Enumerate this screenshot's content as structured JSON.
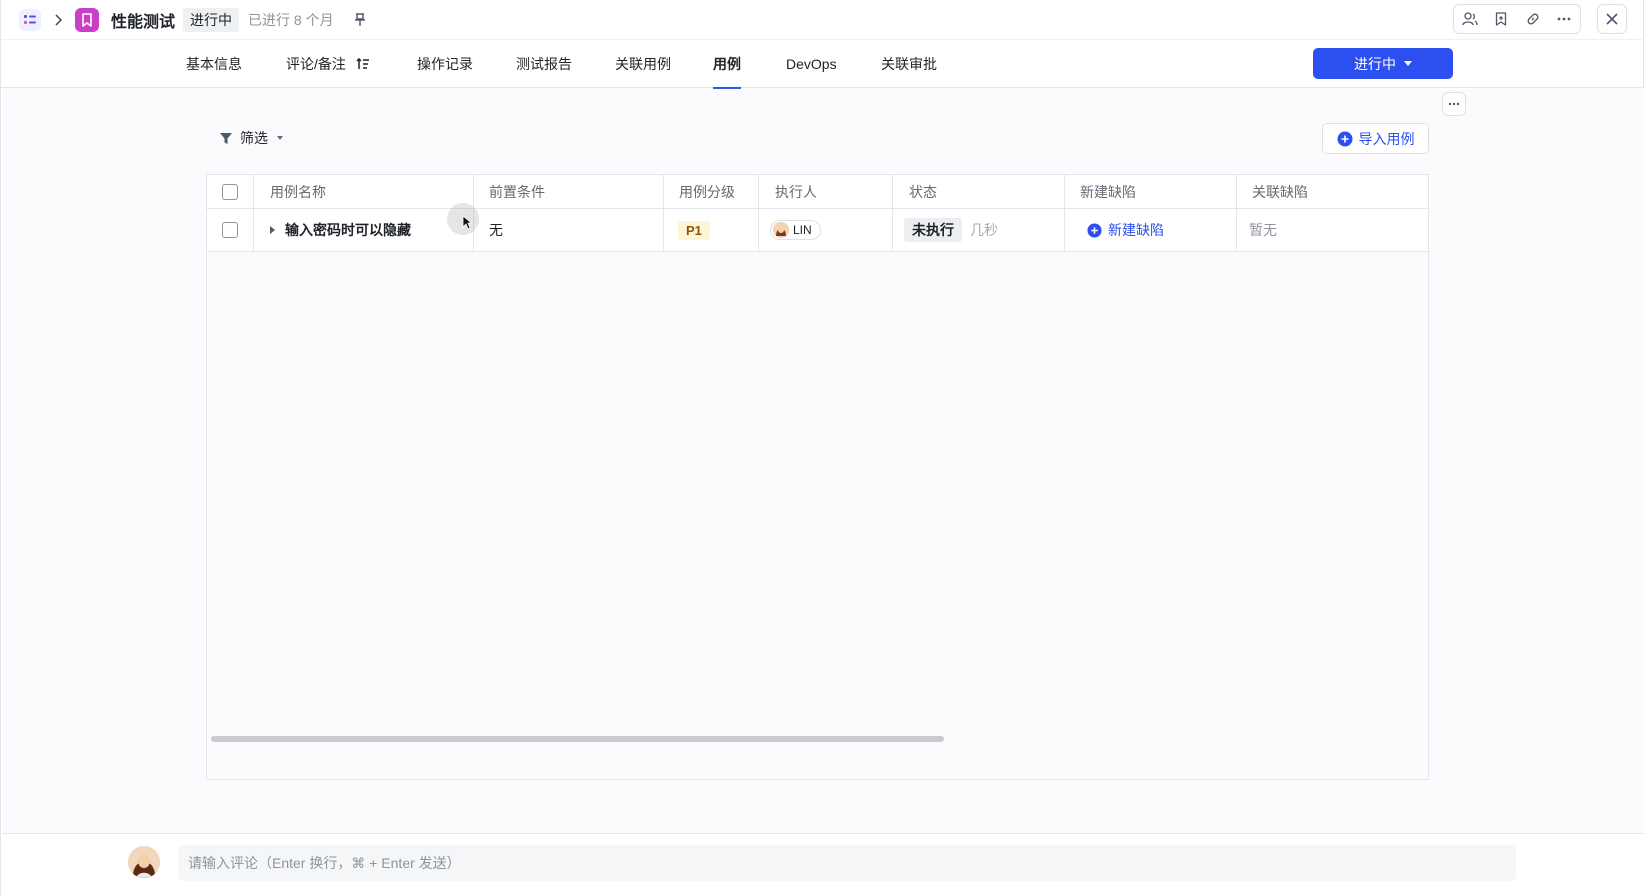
{
  "header": {
    "project_title": "性能测试",
    "status_tag": "进行中",
    "elapsed": "已进行 8 个月"
  },
  "tabs": [
    {
      "label": "基本信息"
    },
    {
      "label": "评论/备注"
    },
    {
      "label": "操作记录"
    },
    {
      "label": "测试报告"
    },
    {
      "label": "关联用例"
    },
    {
      "label": "用例"
    },
    {
      "label": "DevOps"
    },
    {
      "label": "关联审批"
    }
  ],
  "active_tab": "用例",
  "primary_button": {
    "label": "进行中"
  },
  "toolbar": {
    "filter_label": "筛选",
    "import_label": "导入用例"
  },
  "table": {
    "columns": [
      "用例名称",
      "前置条件",
      "用例分级",
      "执行人",
      "状态",
      "新建缺陷",
      "关联缺陷"
    ],
    "rows": [
      {
        "name": "输入密码时可以隐藏",
        "precondition": "无",
        "level": "P1",
        "executor": "LIN",
        "status": "未执行",
        "status_time": "几秒",
        "new_defect": "新建缺陷",
        "linked_defect": "暂无"
      }
    ]
  },
  "comment": {
    "placeholder": "请输入评论（Enter 换行，⌘ + Enter 发送）"
  },
  "colors": {
    "accent": "#2c4ff0",
    "project_icon": "#c940c8",
    "p1_bg": "#fff4d6"
  }
}
